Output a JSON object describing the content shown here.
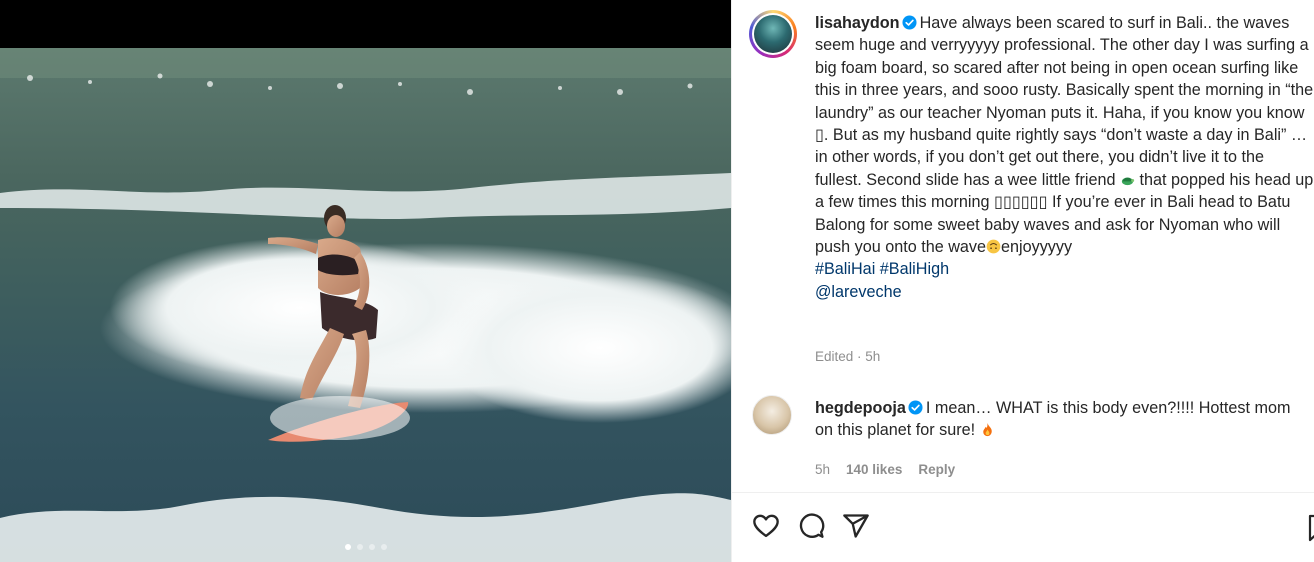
{
  "post": {
    "username": "lisahaydon",
    "caption_text": "Have always been scared to surf in Bali.. the waves seem huge and verryyyyy professional. The other day I was surfing a big foam board, so scared after not being in open ocean surfing like this in three years, and sooo rusty. Basically spent the morning in “the laundry” as our teacher Nyoman puts it. Haha, if you know you know ",
    "caption_text_2": ". But as my husband quite rightly says “don’t waste a day in Bali” … in other words, if you don’t get out there, you didn’t live it to the fullest. Second slide has a wee little friend ",
    "caption_text_3": " that popped his head up a few times this morning ",
    "caption_text_4": " If you’re ever in Bali head to Batu Balong for some sweet baby waves and ask for Nyoman who will push you onto the wave",
    "caption_text_5": "enjoyyyyy",
    "placeholder_glyph_1": "▯",
    "placeholder_glyphs_2": "▯▯▯▯▯▯",
    "hashtags": "#BaliHai #BaliHigh",
    "mention": "@lareveche",
    "edited_time": "Edited · 5h"
  },
  "comment": {
    "username": "hegdepooja",
    "text": "I mean… WHAT is this body even?!!!! Hottest mom on this planet for sure! ",
    "time": "5h",
    "likes": "140 likes",
    "reply": "Reply"
  },
  "carousel": {
    "total": 4,
    "active_index": 1
  },
  "colors": {
    "link": "#00376b",
    "verified": "#0095f6",
    "meta": "#8e8e8e",
    "text": "#262626"
  },
  "icons": [
    "heart-icon",
    "comment-icon",
    "share-icon",
    "bookmark-icon",
    "verified-icon",
    "turtle-emoji",
    "upside-down-face-emoji",
    "fire-emoji"
  ]
}
